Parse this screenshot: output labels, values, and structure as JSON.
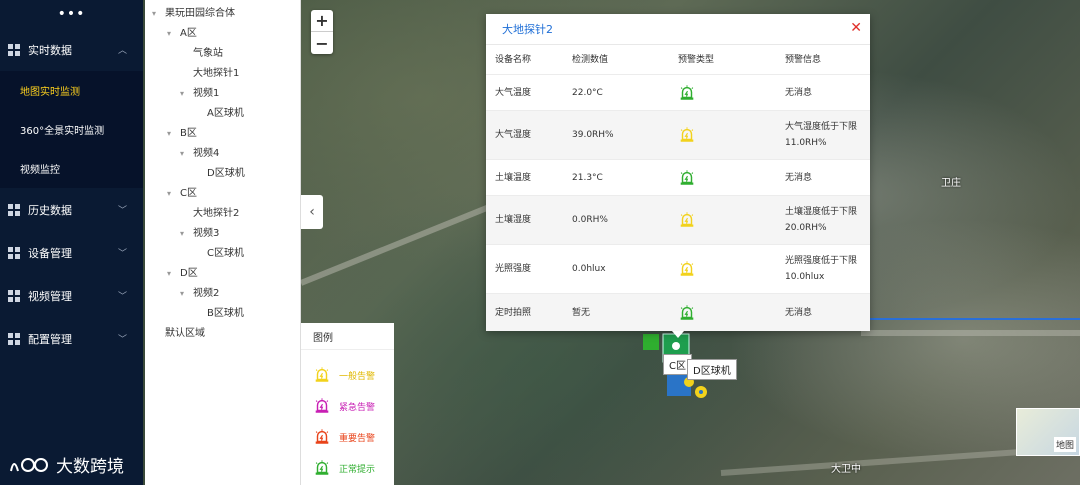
{
  "nav": {
    "top_icon": "more-dots-icon",
    "items": [
      {
        "label": "实时数据",
        "expanded": true
      },
      {
        "label": "历史数据"
      },
      {
        "label": "设备管理"
      },
      {
        "label": "视频管理"
      },
      {
        "label": "配置管理"
      }
    ],
    "sub_items": [
      {
        "label": "地图实时监测",
        "active": true
      },
      {
        "label": "360°全景实时监测"
      },
      {
        "label": "视频监控"
      }
    ],
    "brand": "大数跨境"
  },
  "tree": {
    "root": "果玩田园综合体",
    "nodes": [
      {
        "label": "A区"
      },
      {
        "label": "气象站"
      },
      {
        "label": "大地探针1"
      },
      {
        "label": "视频1"
      },
      {
        "label": "A区球机"
      },
      {
        "label": "B区"
      },
      {
        "label": "视频4"
      },
      {
        "label": "D区球机"
      },
      {
        "label": "C区"
      },
      {
        "label": "大地探针2"
      },
      {
        "label": "视频3"
      },
      {
        "label": "C区球机"
      },
      {
        "label": "D区"
      },
      {
        "label": "视频2"
      },
      {
        "label": "B区球机"
      },
      {
        "label": "默认区域"
      }
    ]
  },
  "map": {
    "zoom_in": "+",
    "zoom_out": "−",
    "labels": [
      "卫庄",
      "大卫中",
      "地图"
    ],
    "marker_tags": [
      "C区",
      "D区球机"
    ]
  },
  "popup": {
    "title": "大地探针2",
    "close": "✕",
    "headers": [
      "设备名称",
      "检测数值",
      "预警类型",
      "预警信息"
    ],
    "rows": [
      {
        "name": "大气温度",
        "value": "22.0°C",
        "alarm": "normal",
        "info": "无消息"
      },
      {
        "name": "大气湿度",
        "value": "39.0RH%",
        "alarm": "general",
        "info": "大气湿度低于下限11.0RH%"
      },
      {
        "name": "土壤温度",
        "value": "21.3°C",
        "alarm": "normal",
        "info": "无消息"
      },
      {
        "name": "土壤湿度",
        "value": "0.0RH%",
        "alarm": "general",
        "info": "土壤湿度低于下限20.0RH%"
      },
      {
        "name": "光照强度",
        "value": "0.0hlux",
        "alarm": "general",
        "info": "光照强度低于下限10.0hlux"
      },
      {
        "name": "定时拍照",
        "value": "暂无",
        "alarm": "normal",
        "info": "无消息"
      }
    ]
  },
  "legend": {
    "title": "图例",
    "items": [
      {
        "label": "一般告警",
        "color": "#f2d21c"
      },
      {
        "label": "紧急告警",
        "color": "#c81fb4"
      },
      {
        "label": "重要告警",
        "color": "#e8431a"
      },
      {
        "label": "正常提示",
        "color": "#2fae2f"
      }
    ]
  },
  "colors": {
    "general": "#f2d21c",
    "urgent": "#c81fb4",
    "important": "#e8431a",
    "normal": "#2fae2f",
    "accent": "#1e6ed6",
    "nav_bg": "#0a1a33",
    "nav_active": "#ffd21e"
  }
}
